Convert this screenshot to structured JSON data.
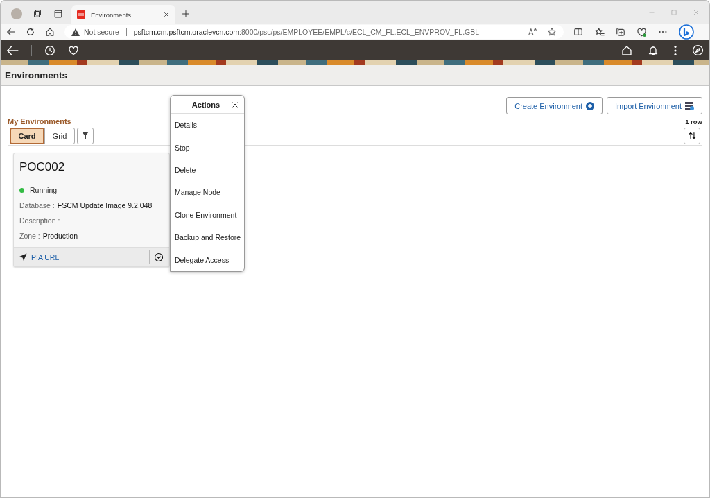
{
  "browser": {
    "tab_title": "Environments",
    "security": "Not secure",
    "host": "psftcm.cm.psftcm.oraclevcn.com",
    "path": ":8000/psc/ps/EMPLOYEE/EMPL/c/ECL_CM_FL.ECL_ENVPROV_FL.GBL"
  },
  "page": {
    "title": "Environments"
  },
  "toolbar_buttons": [
    {
      "label": "Create Environment",
      "kind": "create"
    },
    {
      "label": "Import Environment",
      "kind": "import"
    }
  ],
  "section_title": "My Environments",
  "view_tabs": [
    {
      "label": "Card",
      "selected": true
    },
    {
      "label": "Grid",
      "selected": false
    }
  ],
  "row_count": "1 row",
  "cards": [
    {
      "title": "POC002",
      "status": "Running",
      "color": "#33bb44",
      "fields": [
        {
          "label": "Database :",
          "value": "FSCM Update Image 9.2.048"
        },
        {
          "label": "Description :"
        },
        {
          "label": "Zone :",
          "value": "Production"
        }
      ],
      "link": "PIA URL"
    }
  ],
  "actions_menu": {
    "title": "Actions",
    "items": [
      "Details",
      "Stop",
      "Delete",
      "Manage Node",
      "Clone Environment",
      "Backup and Restore",
      "Delegate Access"
    ]
  }
}
